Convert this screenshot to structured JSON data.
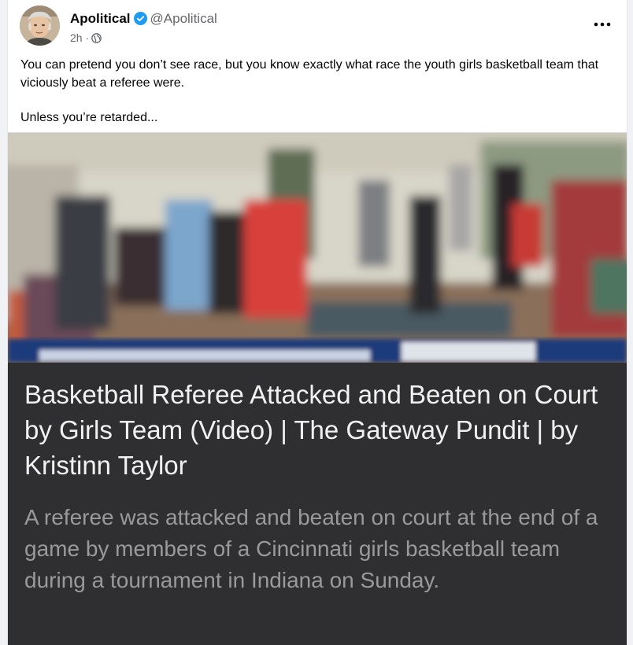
{
  "post": {
    "author_name": "Apolitical",
    "handle": "@Apolitical",
    "time": "2h",
    "separator": "·",
    "text_line1": "You can pretend you don’t see race, but you know exactly what race the youth girls basketball team that viciously beat a referee were.",
    "text_line2": "Unless you’re retarded..."
  },
  "link_preview": {
    "title": "Basketball Referee Attacked and Beaten on Court by Girls Team (Video) | The Gateway Pundit | by Kristinn Taylor",
    "description": "A referee was attacked and beaten on court at the end of a game by members of a Cincinnati girls basketball team during a tournament in Indiana on Sunday."
  },
  "icons": {
    "verified": "verified-badge-icon",
    "audience": "globe-icon",
    "more": "more-options-icon"
  },
  "colors": {
    "verified_blue": "#1d9bf0",
    "preview_background": "#2f2f31",
    "title_text": "#f1f1f1",
    "description_text": "#9a9a9c"
  }
}
